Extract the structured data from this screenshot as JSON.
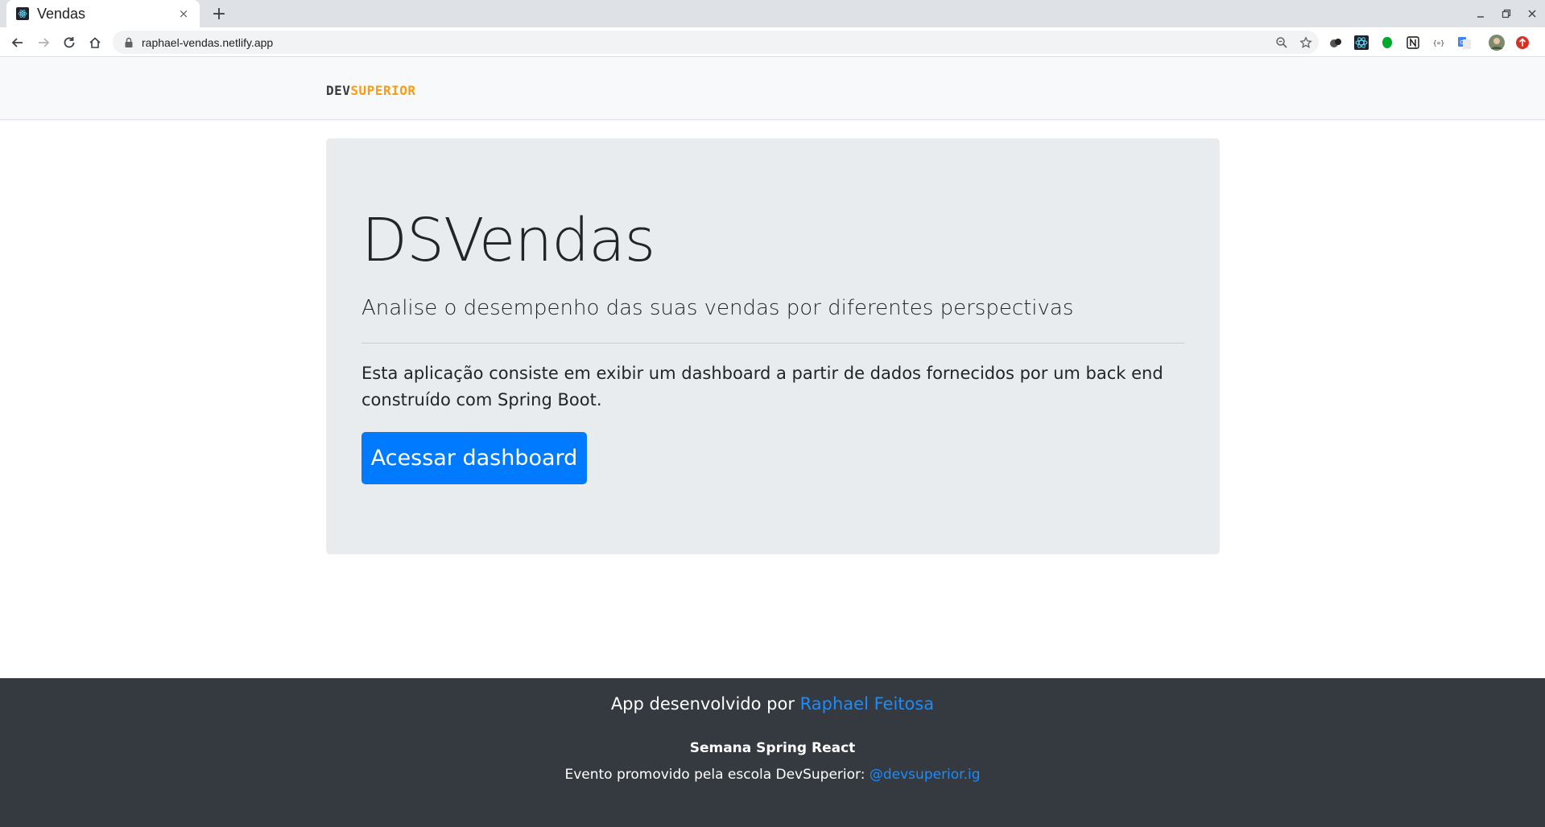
{
  "browser": {
    "tab_title": "Vendas",
    "url": "raphael-vendas.netlify.app",
    "new_tab_label": "+",
    "tab_close_label": "×"
  },
  "navbar": {
    "logo_dev": "DEV",
    "logo_superior": "SUPERIOR",
    "logo_color": "#f89d13"
  },
  "jumbotron": {
    "title": "DSVendas",
    "lead": "Analise o desempenho das suas vendas por diferentes perspectivas",
    "description": "Esta aplicação consiste em exibir um dashboard a partir de dados fornecidos por um back end construído com Spring Boot.",
    "button_label": "Acessar dashboard",
    "button_color": "#007bff"
  },
  "footer": {
    "developed_by": "App desenvolvido por ",
    "author": "Raphael Feitosa",
    "event_title": "Semana Spring React",
    "promoted_by": "Evento promovido pela escola DevSuperior: ",
    "instagram": "@devsuperior.ig",
    "link_color": "#1a8cff"
  }
}
